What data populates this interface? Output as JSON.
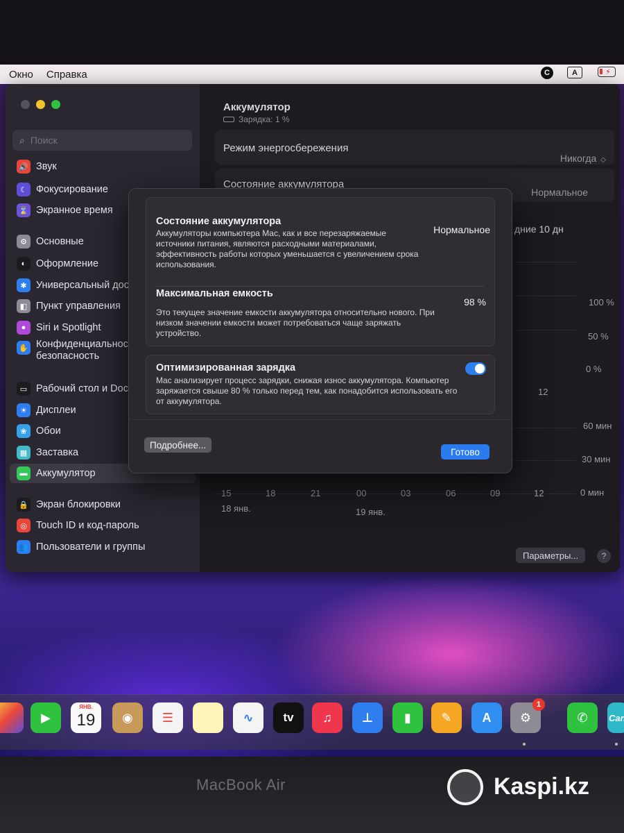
{
  "menubar": {
    "items": [
      "Окно",
      "Справка"
    ],
    "status_c": "C",
    "status_a": "A"
  },
  "sidebar": {
    "search_placeholder": "Поиск",
    "items": [
      {
        "label": "Звук",
        "color": "#e8453c",
        "icon": "speaker-icon",
        "glyph": "🔊"
      },
      {
        "label": "Фокусирование",
        "color": "#5e4fd6",
        "icon": "moon-icon",
        "glyph": "☾"
      },
      {
        "label": "Экранное время",
        "color": "#6a52d9",
        "icon": "hourglass-icon",
        "glyph": "⌛"
      },
      {
        "label": "Основные",
        "color": "#8e8b94",
        "icon": "gear-icon",
        "glyph": "⚙"
      },
      {
        "label": "Оформление",
        "color": "#1c1c1e",
        "icon": "appearance-icon",
        "glyph": "◐"
      },
      {
        "label": "Универсальный дост",
        "color": "#2f7ef0",
        "icon": "accessibility-icon",
        "glyph": "✱"
      },
      {
        "label": "Пункт управления",
        "color": "#8e8b94",
        "icon": "control-center-icon",
        "glyph": "◧"
      },
      {
        "label": "Siri и Spotlight",
        "color": "#b04ad8",
        "icon": "siri-icon",
        "glyph": "●"
      },
      {
        "label": "Конфиденциальность и безопасность",
        "color": "#2f7ef0",
        "icon": "hand-icon",
        "glyph": "✋"
      },
      {
        "label": "Рабочий стол и Dock",
        "color": "#1c1c1e",
        "icon": "desktop-dock-icon",
        "glyph": "▭"
      },
      {
        "label": "Дисплеи",
        "color": "#2f7ef0",
        "icon": "display-icon",
        "glyph": "☀"
      },
      {
        "label": "Обои",
        "color": "#38a0e6",
        "icon": "wallpaper-icon",
        "glyph": "❀"
      },
      {
        "label": "Заставка",
        "color": "#47b8c8",
        "icon": "screensaver-icon",
        "glyph": "▦"
      },
      {
        "label": "Аккумулятор",
        "color": "#34c759",
        "icon": "battery-icon",
        "glyph": "▬"
      },
      {
        "label": "Экран блокировки",
        "color": "#1c1c1e",
        "icon": "lock-icon",
        "glyph": "🔒"
      },
      {
        "label": "Touch ID и код-пароль",
        "color": "#e8453c",
        "icon": "fingerprint-icon",
        "glyph": "◎"
      },
      {
        "label": "Пользователи и группы",
        "color": "#2f7ef0",
        "icon": "users-icon",
        "glyph": "👥"
      }
    ]
  },
  "main": {
    "title": "Аккумулятор",
    "subtitle": "Зарядка: 1 %",
    "low_power_label": "Режим энергосбережения",
    "low_power_value": "Никогда",
    "health_label": "Состояние аккумулятора",
    "health_value": "Нормальное",
    "last_days": "дние 10 дн",
    "level_ticks": [
      "100 %",
      "50 %",
      "0 %"
    ],
    "chart_tick_12": "12",
    "usage_ticks": [
      "60 мин",
      "30 мин",
      "0 мин"
    ],
    "time_ticks": [
      "15",
      "18",
      "21",
      "00",
      "03",
      "06",
      "09",
      "12"
    ],
    "date_1": "18 янв.",
    "date_2": "19 янв.",
    "options_button": "Параметры...",
    "help_button": "?"
  },
  "sheet": {
    "health_title": "Состояние аккумулятора",
    "health_value": "Нормальное",
    "health_desc": "Аккумуляторы компьютера Mac, как и все перезаряжаемые источники питания, являются расходными материалами, эффективность работы которых уменьшается с увеличением срока использования.",
    "capacity_title": "Максимальная емкость",
    "capacity_value": "98 %",
    "capacity_desc": "Это текущее значение емкости аккумулятора относительно нового. При низком значении емкости может потребоваться чаще заряжать устройство.",
    "optimized_title": "Оптимизированная зарядка",
    "optimized_desc": "Mac анализирует процесс зарядки, снижая износ аккумулятора. Компьютер заряжается свыше 80 % только перед тем, как понадобится использовать его от аккумулятора.",
    "optimized_on": true,
    "more_button": "Подробнее...",
    "done_button": "Готово"
  },
  "dock": {
    "calendar_month": "ЯНВ.",
    "calendar_day": "19",
    "tv_label": "tv",
    "settings_badge": "1",
    "last_label": "Can"
  },
  "device": {
    "model_label": "MacBook Air"
  },
  "watermark": {
    "text": "Kaspi.kz"
  }
}
